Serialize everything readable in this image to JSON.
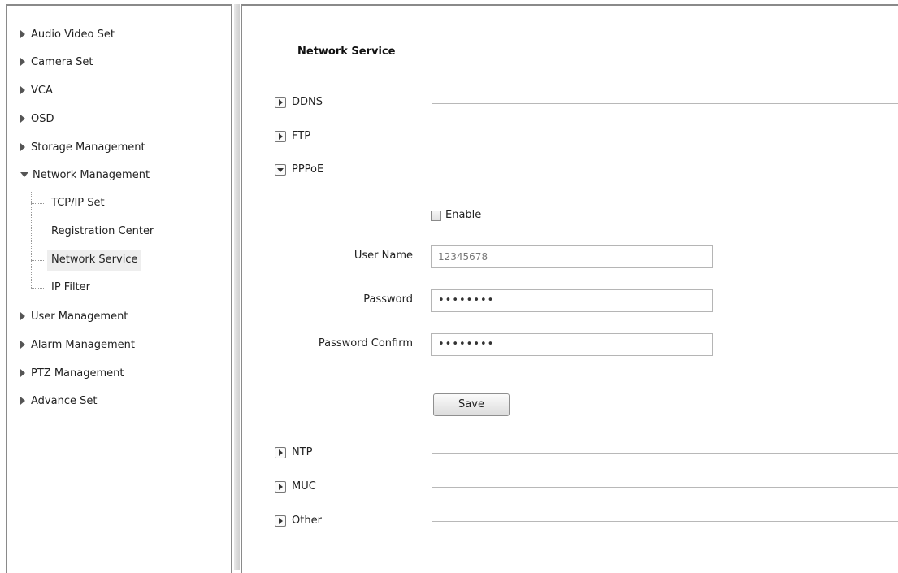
{
  "sidebar": {
    "items": [
      {
        "label": "Audio Video Set"
      },
      {
        "label": "Camera Set"
      },
      {
        "label": "VCA"
      },
      {
        "label": "OSD"
      },
      {
        "label": "Storage Management"
      },
      {
        "label": "Network Management",
        "expanded": true
      },
      {
        "label": "User Management"
      },
      {
        "label": "Alarm Management"
      },
      {
        "label": "PTZ Management"
      },
      {
        "label": "Advance Set"
      }
    ],
    "network_children": [
      {
        "label": "TCP/IP Set"
      },
      {
        "label": "Registration Center"
      },
      {
        "label": "Network Service",
        "active": true
      },
      {
        "label": "IP Filter"
      }
    ]
  },
  "main": {
    "title": "Network Service",
    "sections": {
      "ddns": "DDNS",
      "ftp": "FTP",
      "pppoe": "PPPoE",
      "ntp": "NTP",
      "muc": "MUC",
      "other": "Other"
    },
    "pppoe_form": {
      "enable_label": "Enable",
      "enable_checked": false,
      "user_name_label": "User Name",
      "user_name_value": "12345678",
      "password_label": "Password",
      "password_value": "••••••••",
      "password_confirm_label": "Password Confirm",
      "password_confirm_value": "••••••••",
      "save_label": "Save"
    }
  },
  "icons": {
    "collapsed": "expand-arrow-icon",
    "expanded": "collapse-arrow-icon",
    "nav_collapsed": "triangle-right-icon",
    "nav_expanded": "triangle-down-icon"
  }
}
